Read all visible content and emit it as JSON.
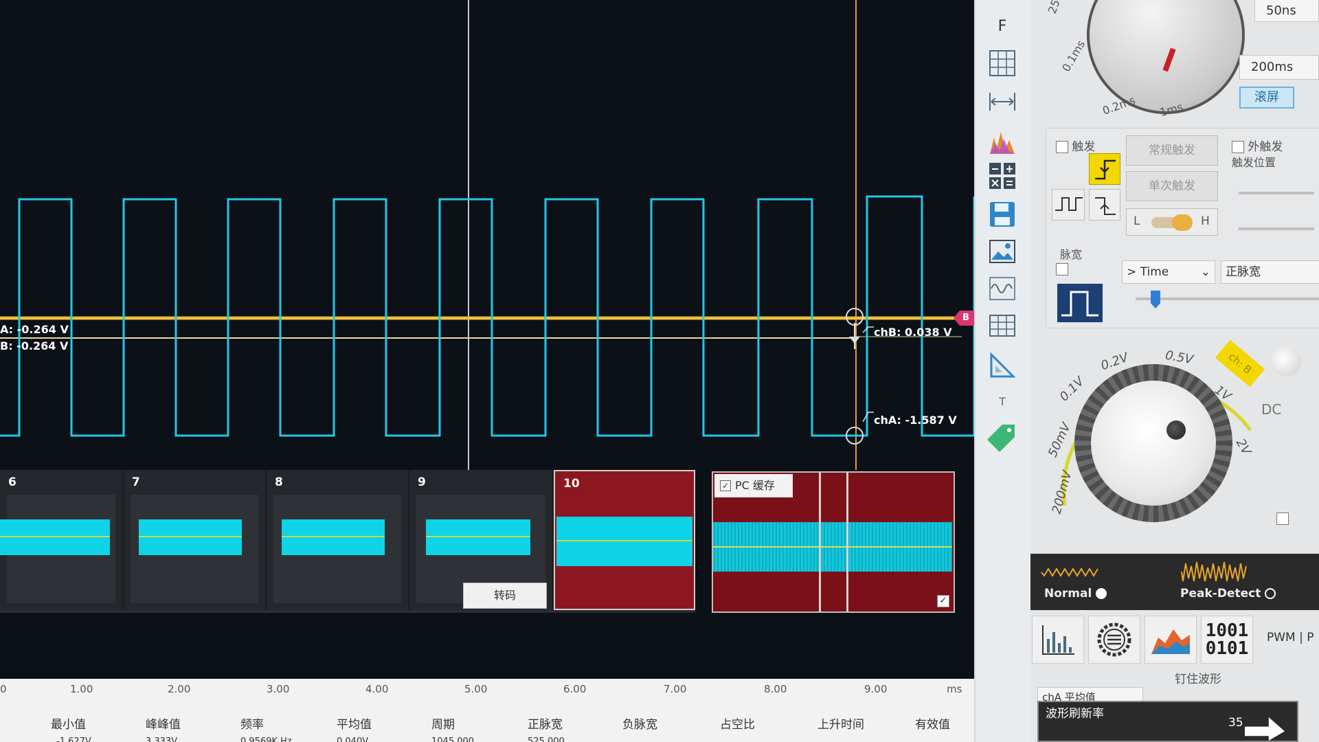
{
  "colors": {
    "chA_wave": "#22c8e8",
    "chB_line": "#e8b02a",
    "cursor": "#e89a3a",
    "history_active": "#8d1720",
    "tag_pink": "#d9366f"
  },
  "scope": {
    "cursor_readouts": {
      "chA_left": "A: -0.264 V",
      "chB_left": "B: -0.264 V",
      "chB_marker": "chB: 0.038 V",
      "chA_marker": "chA: -1.587 V"
    },
    "channel_tag": "B"
  },
  "history": {
    "frames": [
      {
        "num": "6"
      },
      {
        "num": "7"
      },
      {
        "num": "8"
      },
      {
        "num": "9"
      },
      {
        "num": "10"
      }
    ],
    "decode_button": "转码",
    "pc_cache_label": "PC 缓存",
    "pc_cache_checked": true
  },
  "axis": {
    "ticks": [
      "0",
      "1.00",
      "2.00",
      "3.00",
      "4.00",
      "5.00",
      "6.00",
      "7.00",
      "8.00",
      "9.00"
    ],
    "unit": "ms"
  },
  "measurements": {
    "headers": [
      "最小值",
      "峰峰值",
      "频率",
      "平均值",
      "周期",
      "正脉宽",
      "负脉宽",
      "占空比",
      "上升时间",
      "有效值"
    ],
    "values": [
      "-1.627V",
      "3.333V",
      "0.9569K Hz",
      "0.040V",
      "1045.000",
      "525.000",
      "",
      "",
      "",
      ""
    ]
  },
  "toolbar": {
    "items": [
      "F",
      "grid-icon",
      "measure-width-icon",
      "spectrum-icon",
      "math-icon",
      "save-icon",
      "image-icon",
      "waveform-icon",
      "table-icon",
      "ruler-icon",
      "T",
      "tag-icon"
    ]
  },
  "panel": {
    "timebase_field": "50ns",
    "timebase_field2": "200ms",
    "roll_button": "滚屏",
    "dial_labels": [
      "25",
      "0.1ms",
      "0.2ms",
      "1ms"
    ],
    "trigger_label": "触发",
    "external_trigger_label": "外触发",
    "trigger_position_label": "触发位置",
    "normal_trigger_btn": "常规触发",
    "single_trigger_btn": "单次触发",
    "low_label": "L",
    "high_label": "H",
    "pulse_width_label": "脉宽",
    "time_select": "> Time",
    "pulse_select": "正脉宽",
    "volt_labels": [
      "200mV",
      "50mV",
      "0.1V",
      "0.2V",
      "0.5V",
      "1V",
      "2V"
    ],
    "ch_badge": "ch: B",
    "coupling": "DC",
    "acq_normal": "Normal",
    "acq_peak": "Peak-Detect",
    "pwm_label": "PWM | P",
    "pin_wave_label": "钉住波形",
    "avg_select": "chA 平均值",
    "refresh_label": "波形刷新率",
    "refresh_value": "35"
  }
}
